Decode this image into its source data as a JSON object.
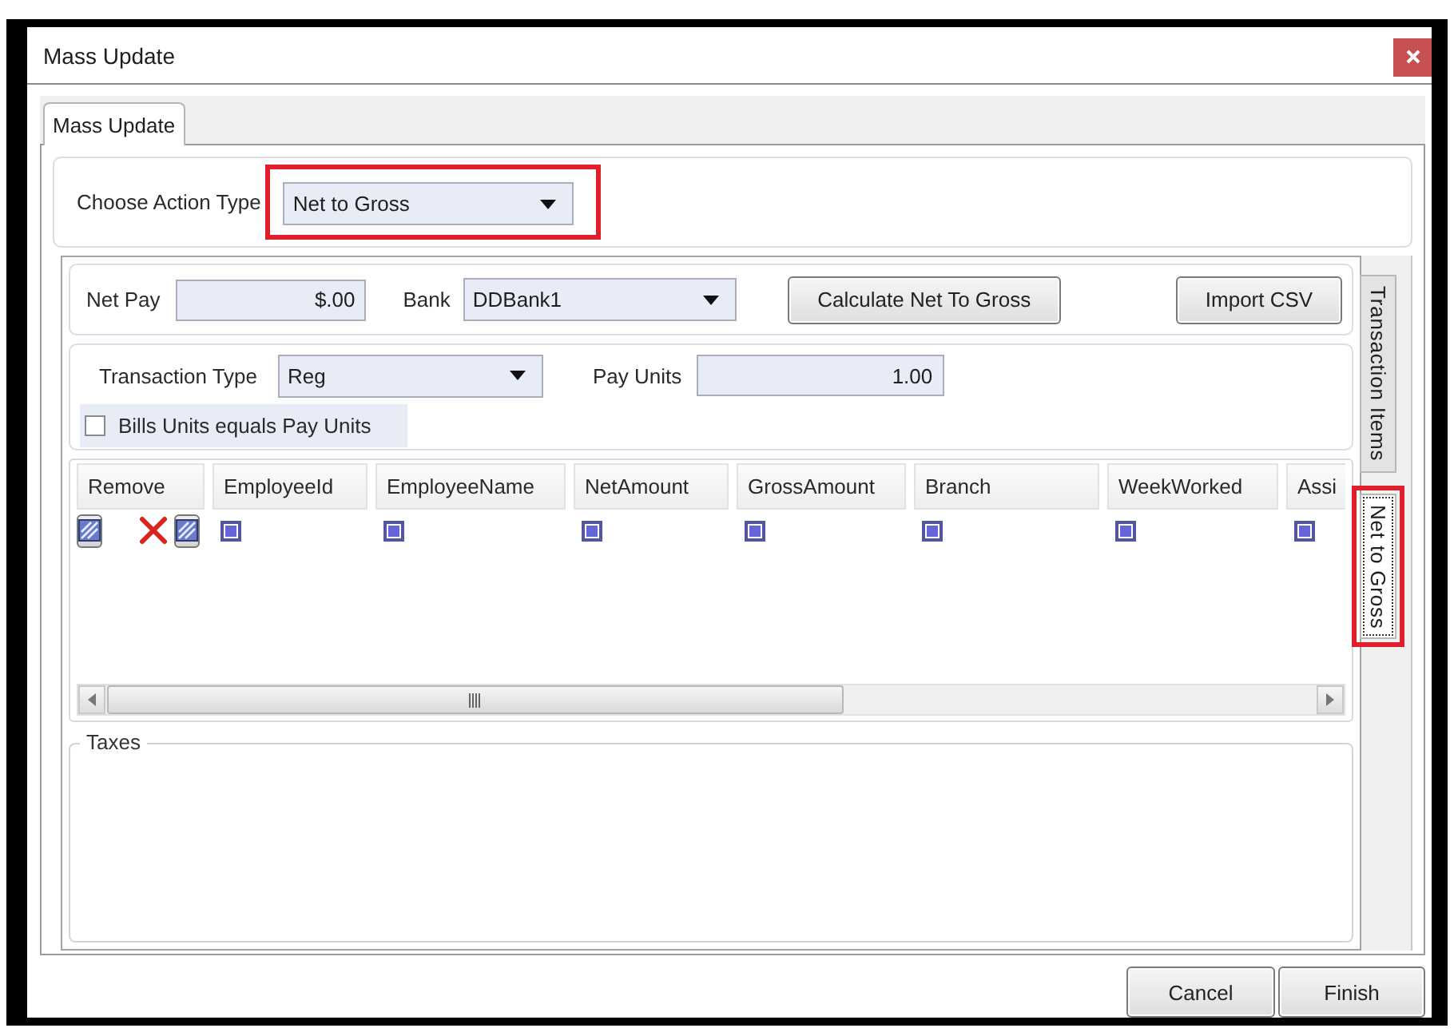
{
  "window": {
    "title": "Mass Update"
  },
  "tabs": [
    {
      "label": "Mass Update",
      "selected": true
    }
  ],
  "action_type": {
    "label": "Choose Action Type",
    "value": "Net to Gross",
    "highlighted": true
  },
  "net_pay": {
    "label": "Net Pay",
    "value": "$.00"
  },
  "bank": {
    "label": "Bank",
    "value": "DDBank1"
  },
  "top_buttons": [
    "Calculate Net To Gross",
    "Import CSV"
  ],
  "transaction_type": {
    "label": "Transaction Type",
    "value": "Reg"
  },
  "pay_units": {
    "label": "Pay Units",
    "value": "1.00"
  },
  "bills_units_checkbox": {
    "label": "Bills Units equals Pay Units",
    "checked": false
  },
  "grid": {
    "columns": [
      {
        "label": "Remove",
        "kind": "remove"
      },
      {
        "label": "EmployeeId",
        "kind": "filter"
      },
      {
        "label": "EmployeeName",
        "kind": "filter"
      },
      {
        "label": "NetAmount",
        "kind": "filter"
      },
      {
        "label": "GrossAmount",
        "kind": "filter"
      },
      {
        "label": "Branch",
        "kind": "filter"
      },
      {
        "label": "WeekWorked",
        "kind": "filter"
      },
      {
        "label": "Assi",
        "kind": "filter"
      }
    ]
  },
  "taxes": {
    "title": "Taxes"
  },
  "side_tabs": [
    {
      "label": "Transaction Items",
      "selected": false,
      "highlighted": false
    },
    {
      "label": "Net to Gross",
      "selected": true,
      "highlighted": true
    }
  ],
  "footer_buttons": [
    "Cancel",
    "Finish"
  ]
}
